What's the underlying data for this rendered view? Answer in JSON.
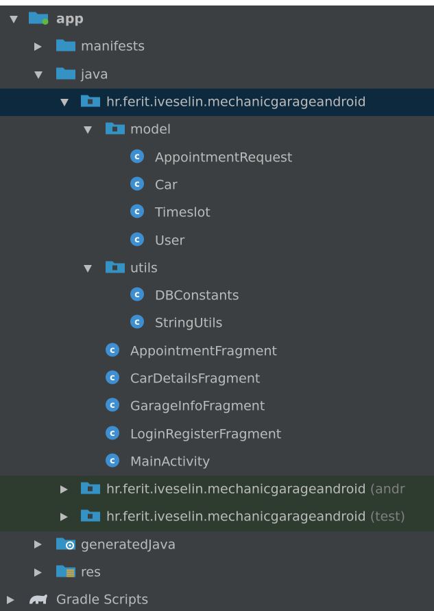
{
  "colors": {
    "panel_bg": "#3c3f41",
    "selected_bg": "#0d293e",
    "tinted_bg": "#2e3b2f",
    "text": "#bbbbbb",
    "muted_text": "#808080",
    "folder_blue": "#3592c4",
    "class_blue": "#3d8fd1",
    "module_green": "#62b543"
  },
  "tree": [
    {
      "label": "app",
      "suffix": "",
      "icon": "module-folder-icon",
      "arrow": "expanded",
      "state": "bold"
    },
    {
      "label": "manifests",
      "suffix": "",
      "icon": "folder-icon",
      "arrow": "collapsed",
      "state": ""
    },
    {
      "label": "java",
      "suffix": "",
      "icon": "source-folder-icon",
      "arrow": "expanded",
      "state": ""
    },
    {
      "label": "hr.ferit.iveselin.mechanicgarageandroid",
      "suffix": "",
      "icon": "package-icon",
      "arrow": "expanded",
      "state": "selected"
    },
    {
      "label": "model",
      "suffix": "",
      "icon": "package-icon",
      "arrow": "expanded",
      "state": ""
    },
    {
      "label": "AppointmentRequest",
      "suffix": "",
      "icon": "class-icon",
      "arrow": "none",
      "state": ""
    },
    {
      "label": "Car",
      "suffix": "",
      "icon": "class-icon",
      "arrow": "none",
      "state": ""
    },
    {
      "label": "Timeslot",
      "suffix": "",
      "icon": "class-icon",
      "arrow": "none",
      "state": ""
    },
    {
      "label": "User",
      "suffix": "",
      "icon": "class-icon",
      "arrow": "none",
      "state": ""
    },
    {
      "label": "utils",
      "suffix": "",
      "icon": "package-icon",
      "arrow": "expanded",
      "state": ""
    },
    {
      "label": "DBConstants",
      "suffix": "",
      "icon": "class-icon",
      "arrow": "none",
      "state": ""
    },
    {
      "label": "StringUtils",
      "suffix": "",
      "icon": "class-icon",
      "arrow": "none",
      "state": ""
    },
    {
      "label": "AppointmentFragment",
      "suffix": "",
      "icon": "class-icon",
      "arrow": "none",
      "state": ""
    },
    {
      "label": "CarDetailsFragment",
      "suffix": "",
      "icon": "class-icon",
      "arrow": "none",
      "state": ""
    },
    {
      "label": "GarageInfoFragment",
      "suffix": "",
      "icon": "class-icon",
      "arrow": "none",
      "state": ""
    },
    {
      "label": "LoginRegisterFragment",
      "suffix": "",
      "icon": "class-icon",
      "arrow": "none",
      "state": ""
    },
    {
      "label": "MainActivity",
      "suffix": "",
      "icon": "class-icon",
      "arrow": "none",
      "state": ""
    },
    {
      "label": "hr.ferit.iveselin.mechanicgarageandroid",
      "suffix": " (andr",
      "icon": "package-icon",
      "arrow": "collapsed",
      "state": "tinted"
    },
    {
      "label": "hr.ferit.iveselin.mechanicgarageandroid",
      "suffix": " (test)",
      "icon": "package-icon",
      "arrow": "collapsed",
      "state": "tinted"
    },
    {
      "label": "generatedJava",
      "suffix": "",
      "icon": "generated-folder-icon",
      "arrow": "collapsed",
      "state": ""
    },
    {
      "label": "res",
      "suffix": "",
      "icon": "resources-folder-icon",
      "arrow": "collapsed",
      "state": ""
    },
    {
      "label": "Gradle Scripts",
      "suffix": "",
      "icon": "gradle-elephant-icon",
      "arrow": "collapsed",
      "state": ""
    }
  ]
}
